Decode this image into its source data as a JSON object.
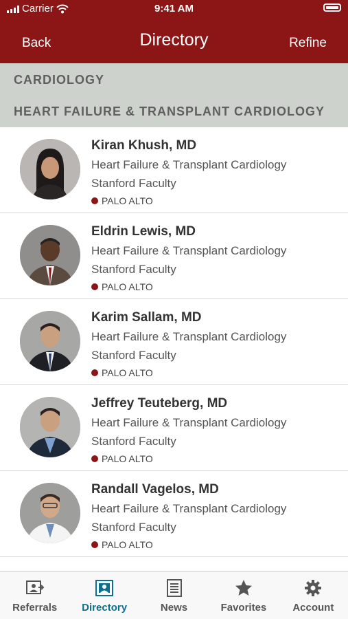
{
  "status_bar": {
    "carrier": "Carrier",
    "time": "9:41 AM"
  },
  "nav": {
    "back_label": "Back",
    "title": "Directory",
    "refine_label": "Refine"
  },
  "section": {
    "category": "CARDIOLOGY",
    "subcategory": "HEART FAILURE & TRANSPLANT CARDIOLOGY"
  },
  "doctors": [
    {
      "name": "Kiran Khush, MD",
      "specialty": "Heart Failure & Transplant Cardiology",
      "affiliation": "Stanford Faculty",
      "location": "PALO ALTO"
    },
    {
      "name": "Eldrin Lewis, MD",
      "specialty": "Heart Failure & Transplant Cardiology",
      "affiliation": "Stanford Faculty",
      "location": "PALO ALTO"
    },
    {
      "name": "Karim Sallam, MD",
      "specialty": "Heart Failure & Transplant Cardiology",
      "affiliation": "Stanford Faculty",
      "location": "PALO ALTO"
    },
    {
      "name": "Jeffrey Teuteberg, MD",
      "specialty": "Heart Failure & Transplant Cardiology",
      "affiliation": "Stanford Faculty",
      "location": "PALO ALTO"
    },
    {
      "name": "Randall Vagelos, MD",
      "specialty": "Heart Failure & Transplant Cardiology",
      "affiliation": "Stanford Faculty",
      "location": "PALO ALTO"
    }
  ],
  "tabs": [
    {
      "label": "Referrals",
      "icon": "referrals-icon"
    },
    {
      "label": "Directory",
      "icon": "directory-icon",
      "active": true
    },
    {
      "label": "News",
      "icon": "news-icon"
    },
    {
      "label": "Favorites",
      "icon": "star-icon"
    },
    {
      "label": "Account",
      "icon": "gear-icon"
    }
  ],
  "colors": {
    "brand": "#8c1515",
    "section_bg": "#cdd3cc",
    "active_tab": "#0e6f8a"
  }
}
